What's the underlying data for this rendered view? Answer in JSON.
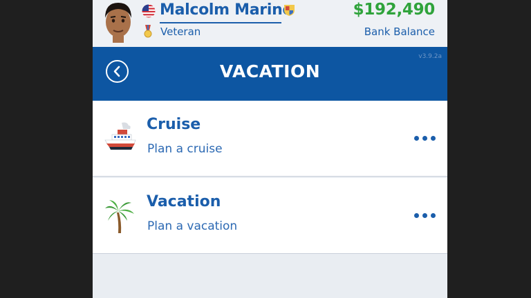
{
  "player": {
    "name": "Malcolm Marino",
    "title": "Veteran",
    "avatar_icon": "avatar-icon",
    "flag_icon": "us-flag-icon",
    "medal_icon": "medal-icon",
    "crest_icon": "crest-icon"
  },
  "bank": {
    "amount": "$192,490",
    "label": "Bank Balance"
  },
  "nav": {
    "title": "VACATION",
    "version": "v3.9.2a",
    "back_icon": "back-arrow-icon"
  },
  "items": [
    {
      "title": "Cruise",
      "subtitle": "Plan a cruise",
      "icon": "cruise-ship-icon"
    },
    {
      "title": "Vacation",
      "subtitle": "Plan a vacation",
      "icon": "palm-tree-icon"
    }
  ],
  "colors": {
    "primary": "#0d56a2",
    "text_blue": "#1b5eab",
    "money_green": "#2fa33b",
    "background": "#e9edf2"
  }
}
